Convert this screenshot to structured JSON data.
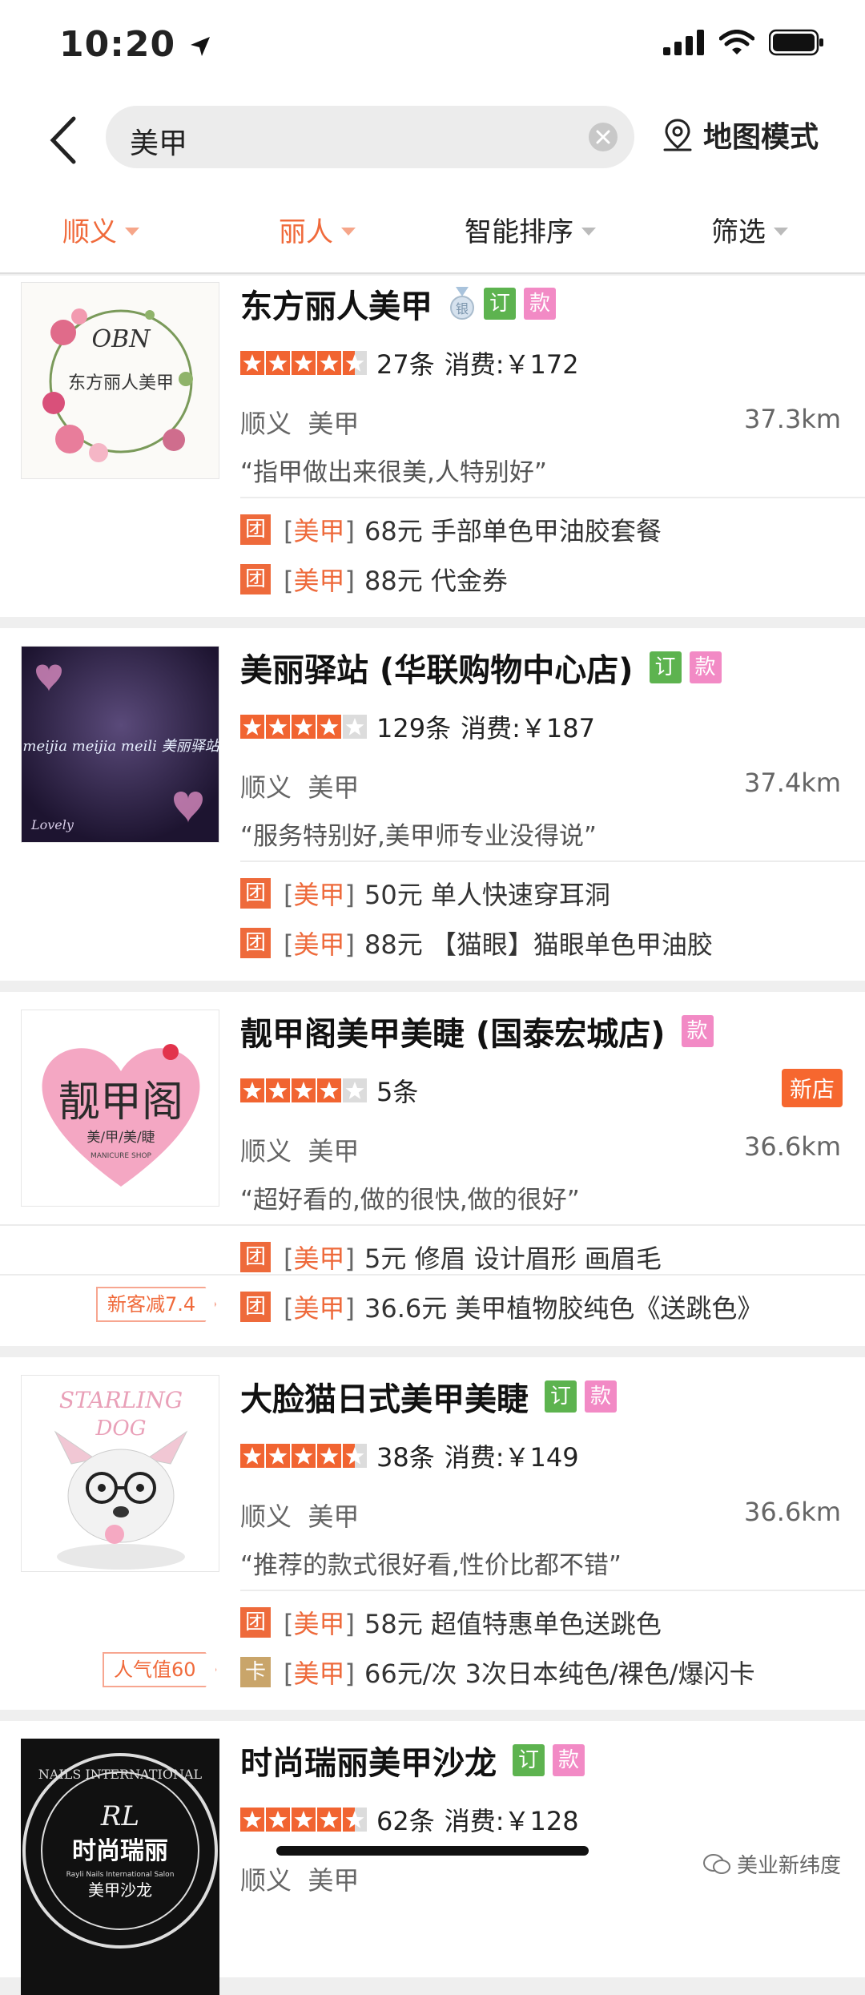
{
  "status_bar": {
    "time": "10:20"
  },
  "search": {
    "query": "美甲",
    "map_mode_label": "地图模式"
  },
  "filters": [
    {
      "label": "顺义",
      "active": true
    },
    {
      "label": "丽人",
      "active": true
    },
    {
      "label": "智能排序",
      "active": false
    },
    {
      "label": "筛选",
      "active": false
    }
  ],
  "shops": [
    {
      "name": "东方丽人美甲",
      "medal": "银",
      "tag_ding": "订",
      "tag_kuan": "款",
      "rating": 4.5,
      "review_count": "27条",
      "spend": "消费:￥172",
      "area": "顺义",
      "category": "美甲",
      "distance": "37.3km",
      "quote": "“指甲做出来很美,人特别好”",
      "thumb_text": [
        "OBN",
        "东方丽人美甲"
      ],
      "deals": [
        {
          "badge": "团",
          "category": "美甲",
          "text": "68元 手部单色甲油胶套餐"
        },
        {
          "badge": "团",
          "category": "美甲",
          "text": "88元 代金券"
        }
      ]
    },
    {
      "name": "美丽驿站 (华联购物中心店)",
      "tag_ding": "订",
      "tag_kuan": "款",
      "rating": 4,
      "review_count": "129条",
      "spend": "消费:￥187",
      "area": "顺义",
      "category": "美甲",
      "distance": "37.4km",
      "quote": "“服务特别好,美甲师专业没得说”",
      "thumb_text": [
        "meijia meijia meili 美丽驿站",
        "Lovely"
      ],
      "deals": [
        {
          "badge": "团",
          "category": "美甲",
          "text": "50元 单人快速穿耳洞"
        },
        {
          "badge": "团",
          "category": "美甲",
          "text": "88元 【猫眼】猫眼单色甲油胶"
        }
      ]
    },
    {
      "name": "靓甲阁美甲美睫 (国泰宏城店)",
      "tag_kuan": "款",
      "rating": 4,
      "review_count": "5条",
      "new_badge": "新店",
      "area": "顺义",
      "category": "美甲",
      "distance": "36.6km",
      "quote": "“超好看的,做的很快,做的很好”",
      "thumb_text": [
        "靓甲阁",
        "美/甲/美/睫",
        "MANICURE SHOP"
      ],
      "promo": "新客减7.4",
      "deals": [
        {
          "badge": "团",
          "category": "美甲",
          "text": "5元 修眉   设计眉形   画眉毛"
        },
        {
          "badge": "团",
          "category": "美甲",
          "text": "36.6元 美甲植物胶纯色《送跳色》"
        }
      ]
    },
    {
      "name": "大脸猫日式美甲美睫",
      "tag_ding": "订",
      "tag_kuan": "款",
      "rating": 4.5,
      "review_count": "38条",
      "spend": "消费:￥149",
      "area": "顺义",
      "category": "美甲",
      "distance": "36.6km",
      "quote": "“推荐的款式很好看,性价比都不错”",
      "thumb_text": [
        "STARLING",
        "DOG"
      ],
      "promo": "人气值60",
      "deals": [
        {
          "badge": "团",
          "category": "美甲",
          "text": "58元 超值特惠单色送跳色"
        },
        {
          "badge": "卡",
          "category": "美甲",
          "text": "66元/次 3次日本纯色/裸色/爆闪卡"
        }
      ]
    },
    {
      "name": "时尚瑞丽美甲沙龙",
      "tag_ding": "订",
      "tag_kuan": "款",
      "rating": 4.5,
      "review_count": "62条",
      "spend": "消费:￥128",
      "area": "顺义",
      "category": "美甲",
      "thumb_text": [
        "NAILS INTERNATIONAL",
        "RL",
        "时尚瑞丽",
        "Rayli Nails International Salon",
        "美甲沙龙"
      ]
    }
  ],
  "watermark": "美业新纬度"
}
